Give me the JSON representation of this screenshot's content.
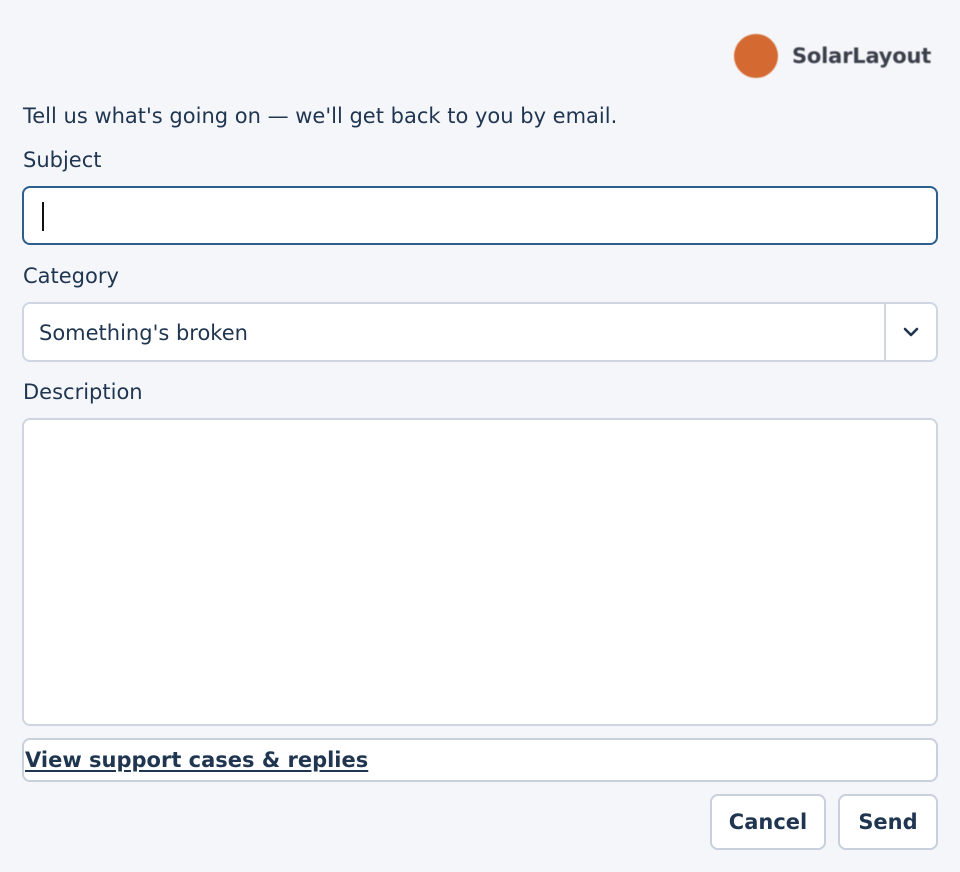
{
  "brand": {
    "name": "SolarLayout",
    "logo_color": "#d46a32"
  },
  "form": {
    "intro": "Tell us what's going on — we'll get back to you by email.",
    "subject": {
      "label": "Subject",
      "value": ""
    },
    "category": {
      "label": "Category",
      "value": "Something's broken",
      "icon": "chevron-down-icon"
    },
    "description": {
      "label": "Description",
      "value": ""
    },
    "support_link": "View support cases & replies"
  },
  "actions": {
    "cancel_label": "Cancel",
    "send_label": "Send"
  },
  "colors": {
    "text": "#1f3550",
    "focus_border": "#2d5f8c",
    "border": "#cfd6e2",
    "background": "#f5f6fa"
  }
}
